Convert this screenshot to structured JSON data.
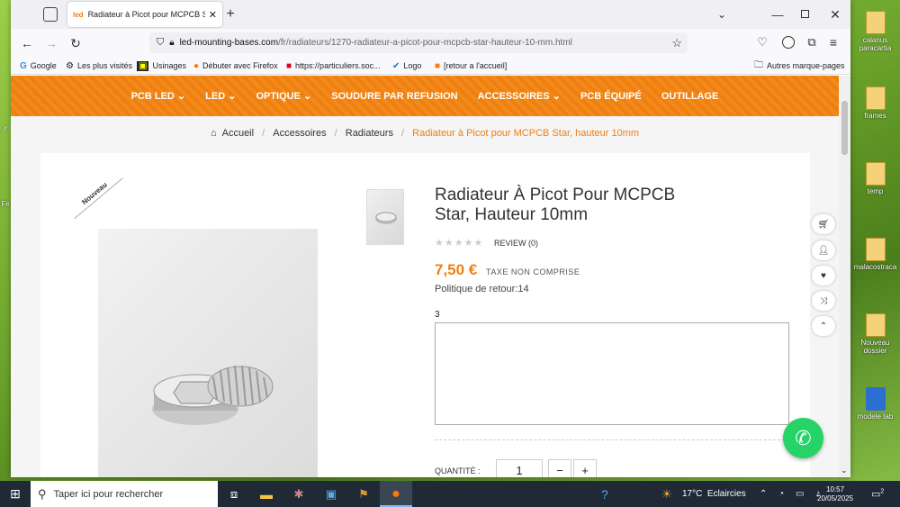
{
  "desktop": {
    "icons": [
      {
        "label": "calanus paracartia"
      },
      {
        "label": "frames"
      },
      {
        "label": "temp"
      },
      {
        "label": "malacostraca"
      },
      {
        "label": "Nouveau dossier"
      },
      {
        "label": "modele tab"
      }
    ],
    "left_edge": [
      "jr",
      "Fe"
    ]
  },
  "browser": {
    "tab_title": "Radiateur à Picot pour MCPCB S",
    "tab_favicon": "led",
    "url_domain": "led-mounting-bases.com",
    "url_path": "/fr/radiateurs/1270-radiateur-a-picot-pour-mcpcb-star-hauteur-10-mm.html",
    "bookmarks": [
      "Google",
      "Les plus visités",
      "Usinages",
      "Débuter avec Firefox",
      "https://particuliers.soc...",
      "Logo",
      "[retour a l'accueil]"
    ],
    "other_bookmarks": "Autres marque-pages"
  },
  "site": {
    "menu": [
      "PCB LED",
      "LED",
      "OPTIQUE",
      "SOUDURE PAR REFUSION",
      "ACCESSOIRES",
      "PCB ÉQUIPÉ",
      "OUTILLAGE"
    ],
    "menu_has_dropdown": [
      true,
      true,
      true,
      false,
      true,
      false,
      false
    ],
    "breadcrumb": {
      "home": "Accueil",
      "items": [
        "Accessoires",
        "Radiateurs"
      ],
      "current": "Radiateur à Picot pour MCPCB Star, hauteur 10mm"
    },
    "product": {
      "badge": "Nouveau",
      "title": "Radiateur À Picot Pour MCPCB Star, Hauteur 10mm",
      "review": "REVIEW (0)",
      "rating": 0,
      "price": "7,50 €",
      "tax": "TAXE NON COMPRISE",
      "return_policy": "Politique de retour:14",
      "field_label": "3",
      "quantity_label": "QUANTITÉ :",
      "quantity": "1",
      "minus": "−",
      "plus": "+"
    },
    "accent": "#f07f12"
  },
  "taskbar": {
    "search_placeholder": "Taper ici pour rechercher",
    "weather": "17°C  Eclaircies",
    "time": "10:57",
    "date": "20/05/2025",
    "notif_count": "2"
  }
}
